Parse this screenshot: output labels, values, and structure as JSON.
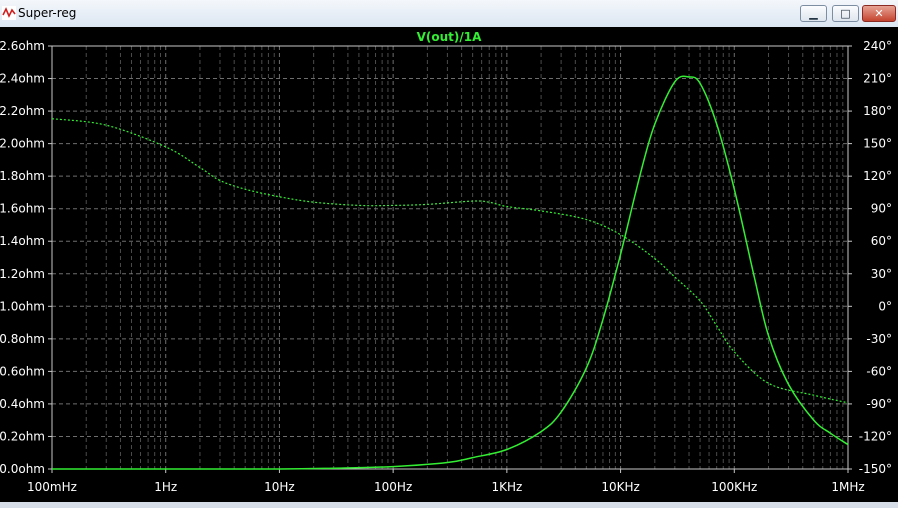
{
  "window": {
    "title": "Super-reg",
    "minimize_glyph": "▁",
    "maximize_glyph": "□",
    "close_glyph": "✕",
    "icon": "waveform-icon"
  },
  "colors": {
    "background": "#000000",
    "grid": "#8a8a8a",
    "trace": "#33ee33",
    "text": "#ffffff"
  },
  "chart_data": {
    "type": "line",
    "title": "V(out)/1A",
    "x_scale": "log",
    "x_ticks": [
      {
        "value": 0.1,
        "label": "100mHz"
      },
      {
        "value": 1,
        "label": "1Hz"
      },
      {
        "value": 10,
        "label": "10Hz"
      },
      {
        "value": 100,
        "label": "100Hz"
      },
      {
        "value": 1000,
        "label": "1KHz"
      },
      {
        "value": 10000,
        "label": "10KHz"
      },
      {
        "value": 100000,
        "label": "100KHz"
      },
      {
        "value": 1000000,
        "label": "1MHz"
      }
    ],
    "xlim": [
      0.1,
      1000000
    ],
    "ylim_left": [
      0,
      2.6
    ],
    "ylim_right": [
      -150,
      240
    ],
    "y_ticks_left": [
      {
        "value": 0.0,
        "label": "0.0ohm"
      },
      {
        "value": 0.2,
        "label": "0.2ohm"
      },
      {
        "value": 0.4,
        "label": "0.4ohm"
      },
      {
        "value": 0.6,
        "label": "0.6ohm"
      },
      {
        "value": 0.8,
        "label": "0.8ohm"
      },
      {
        "value": 1.0,
        "label": "1.0ohm"
      },
      {
        "value": 1.2,
        "label": "1.2ohm"
      },
      {
        "value": 1.4,
        "label": "1.4ohm"
      },
      {
        "value": 1.6,
        "label": "1.6ohm"
      },
      {
        "value": 1.8,
        "label": "1.8ohm"
      },
      {
        "value": 2.0,
        "label": "2.0ohm"
      },
      {
        "value": 2.2,
        "label": "2.2ohm"
      },
      {
        "value": 2.4,
        "label": "2.4ohm"
      },
      {
        "value": 2.6,
        "label": "2.6ohm"
      }
    ],
    "y_ticks_right": [
      {
        "value": -150,
        "label": "-150°"
      },
      {
        "value": -120,
        "label": "-120°"
      },
      {
        "value": -90,
        "label": "-90°"
      },
      {
        "value": -60,
        "label": "-60°"
      },
      {
        "value": -30,
        "label": "-30°"
      },
      {
        "value": 0,
        "label": "0°"
      },
      {
        "value": 30,
        "label": "30°"
      },
      {
        "value": 60,
        "label": "60°"
      },
      {
        "value": 90,
        "label": "90°"
      },
      {
        "value": 120,
        "label": "120°"
      },
      {
        "value": 150,
        "label": "150°"
      },
      {
        "value": 180,
        "label": "180°"
      },
      {
        "value": 210,
        "label": "210°"
      },
      {
        "value": 240,
        "label": "240°"
      }
    ],
    "grid": true,
    "series": [
      {
        "axis": "left",
        "style": "solid",
        "x": [
          0.1,
          1,
          10,
          30,
          100,
          300,
          500,
          1000,
          2000,
          3000,
          5000,
          7000,
          10000,
          15000,
          20000,
          30000,
          40000,
          50000,
          70000,
          100000,
          150000,
          200000,
          300000,
          500000,
          700000,
          1000000
        ],
        "y": [
          0.0,
          0.0,
          0.0,
          0.005,
          0.015,
          0.04,
          0.07,
          0.12,
          0.23,
          0.35,
          0.62,
          0.92,
          1.32,
          1.82,
          2.12,
          2.38,
          2.41,
          2.37,
          2.12,
          1.72,
          1.18,
          0.82,
          0.52,
          0.3,
          0.22,
          0.15
        ]
      },
      {
        "axis": "right",
        "style": "dotted",
        "x": [
          0.1,
          0.3,
          1,
          2,
          3,
          5,
          10,
          20,
          50,
          100,
          200,
          500,
          700,
          1000,
          2000,
          5000,
          10000,
          20000,
          30000,
          50000,
          70000,
          100000,
          200000,
          500000,
          1000000
        ],
        "y": [
          173,
          167,
          147,
          128,
          116,
          108,
          101,
          96,
          93,
          93,
          94,
          97,
          96,
          92,
          88,
          80,
          66,
          44,
          27,
          5,
          -18,
          -42,
          -71,
          -82,
          -89
        ]
      }
    ]
  }
}
